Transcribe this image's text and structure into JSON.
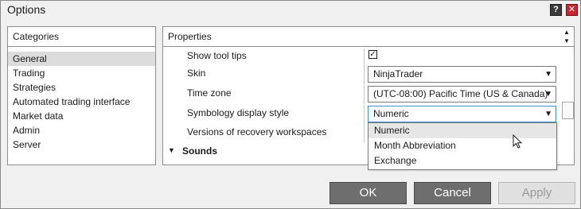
{
  "window": {
    "title": "Options",
    "help_icon": "question-mark-icon",
    "close_icon": "close-icon",
    "close_color": "#c8252c"
  },
  "categories": {
    "header": "Categories",
    "items": [
      {
        "label": "General",
        "selected": true
      },
      {
        "label": "Trading",
        "selected": false
      },
      {
        "label": "Strategies",
        "selected": false
      },
      {
        "label": "Automated trading interface",
        "selected": false
      },
      {
        "label": "Market data",
        "selected": false
      },
      {
        "label": "Admin",
        "selected": false
      },
      {
        "label": "Server",
        "selected": false
      }
    ]
  },
  "properties": {
    "header": "Properties",
    "rows": {
      "show_tool_tips": {
        "label": "Show tool tips",
        "checked": true
      },
      "skin": {
        "label": "Skin",
        "value": "NinjaTrader"
      },
      "time_zone": {
        "label": "Time zone",
        "value": "(UTC-08:00) Pacific Time (US & Canada)"
      },
      "symbology": {
        "label": "Symbology display style",
        "value": "Numeric"
      },
      "recovery": {
        "label": "Versions of recovery workspaces"
      }
    },
    "section": {
      "label": "Sounds",
      "expanded": true
    }
  },
  "dropdown": {
    "options": [
      "Numeric",
      "Month Abbreviation",
      "Exchange"
    ],
    "highlighted": "Numeric"
  },
  "buttons": {
    "ok": "OK",
    "cancel": "Cancel",
    "apply": "Apply"
  },
  "colors": {
    "primary_button": "#6e6e6e",
    "selected_category": "#dcdcdc",
    "active_combo_border": "#3a8fd8"
  }
}
